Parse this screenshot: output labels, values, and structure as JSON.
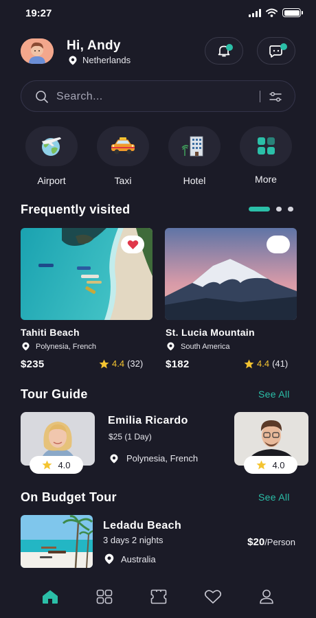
{
  "status_bar": {
    "time": "19:27"
  },
  "header": {
    "greeting": "Hi, Andy",
    "location": "Netherlands",
    "notification_badge_color": "#2bbfa8"
  },
  "search": {
    "placeholder": "Search..."
  },
  "categories": [
    {
      "label": "Airport",
      "icon": "globe-airplane-icon"
    },
    {
      "label": "Taxi",
      "icon": "taxi-icon"
    },
    {
      "label": "Hotel",
      "icon": "hotel-building-icon"
    },
    {
      "label": "More",
      "icon": "grid-more-icon"
    }
  ],
  "frequently_visited": {
    "title": "Frequently visited",
    "pager": {
      "total": 3,
      "active": 1
    },
    "places": [
      {
        "name": "Tahiti Beach",
        "location": "Polynesia, French",
        "price": "$235",
        "rating": "4.4",
        "reviews": "(32)",
        "favorited": true
      },
      {
        "name": "St. Lucia Mountain",
        "location": "South America",
        "price": "$182",
        "rating": "4.4",
        "reviews": "(41)",
        "favorited": false
      }
    ]
  },
  "tour_guide": {
    "title": "Tour Guide",
    "see_all": "See All",
    "guides": [
      {
        "rating": "4.0"
      },
      {
        "name": "Emilia Ricardo",
        "price": "$25 (1 Day)",
        "location": "Polynesia, French"
      },
      {
        "rating": "4.0"
      }
    ]
  },
  "budget_tour": {
    "title": "On Budget Tour",
    "see_all": "See All",
    "item": {
      "name": "Ledadu Beach",
      "duration": "3 days 2 nights",
      "location": "Australia",
      "price": "$20",
      "unit": "/Person"
    }
  },
  "bottom_nav": {
    "active_index": 0,
    "items": [
      "home-icon",
      "grid-icon",
      "ticket-icon",
      "heart-icon",
      "profile-icon"
    ]
  },
  "colors": {
    "background": "#1b1b27",
    "accent": "#2bbfa8",
    "star": "#f4c431",
    "heart": "#e0374a"
  }
}
